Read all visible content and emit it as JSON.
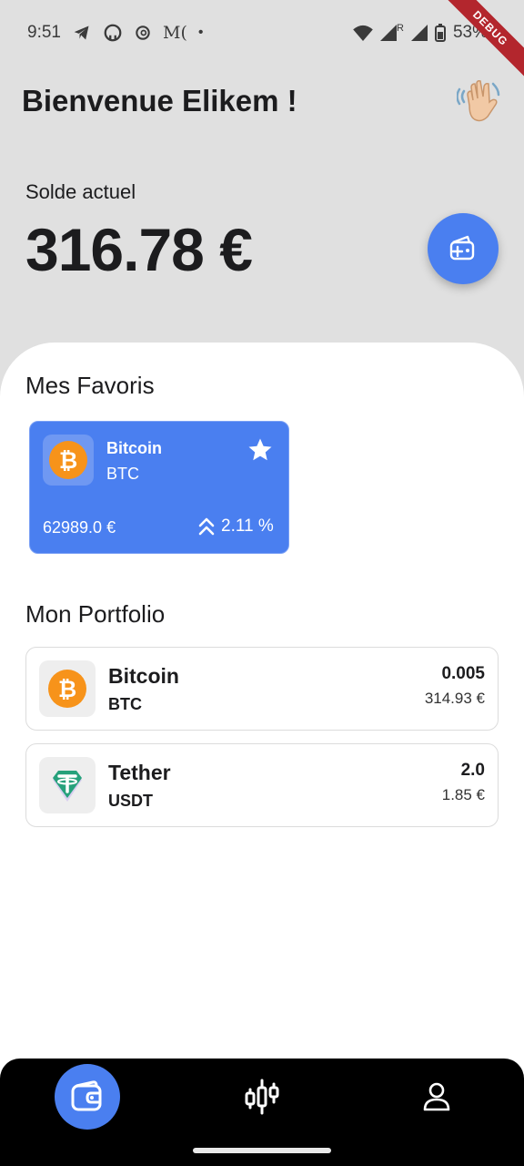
{
  "status_bar": {
    "time": "9:51",
    "battery": "53%",
    "network_indicator": "R",
    "notification_dot": "•",
    "app_icons": [
      "telegram-icon",
      "github-icon",
      "threads-icon",
      "medium-icon"
    ],
    "medium_label": "M("
  },
  "debug_banner": "DEBUG",
  "header": {
    "welcome": "Bienvenue Elikem !",
    "wave_icon": "waving-hand-icon"
  },
  "balance": {
    "label": "Solde actuel",
    "value": "316.78 €",
    "add_button_icon": "wallet-add-icon"
  },
  "favorites": {
    "title": "Mes Favoris",
    "items": [
      {
        "name": "Bitcoin",
        "symbol": "BTC",
        "price": "62989.0 €",
        "change": "2.11 %",
        "icon": "bitcoin-icon",
        "starred": true
      }
    ]
  },
  "portfolio": {
    "title": "Mon Portfolio",
    "items": [
      {
        "name": "Bitcoin",
        "symbol": "BTC",
        "amount": "0.005",
        "value": "314.93 €",
        "icon": "bitcoin-icon"
      },
      {
        "name": "Tether",
        "symbol": "USDT",
        "amount": "2.0",
        "value": "1.85 €",
        "icon": "tether-icon"
      }
    ]
  },
  "bottom_nav": {
    "items": [
      {
        "name": "wallet",
        "icon": "wallet-icon",
        "active": true
      },
      {
        "name": "markets",
        "icon": "candlestick-chart-icon",
        "active": false
      },
      {
        "name": "profile",
        "icon": "user-icon",
        "active": false
      }
    ]
  },
  "colors": {
    "accent": "#4a7ff0",
    "background": "#e0e0e0",
    "bitcoin": "#f7931a",
    "tether": "#26a17b"
  }
}
